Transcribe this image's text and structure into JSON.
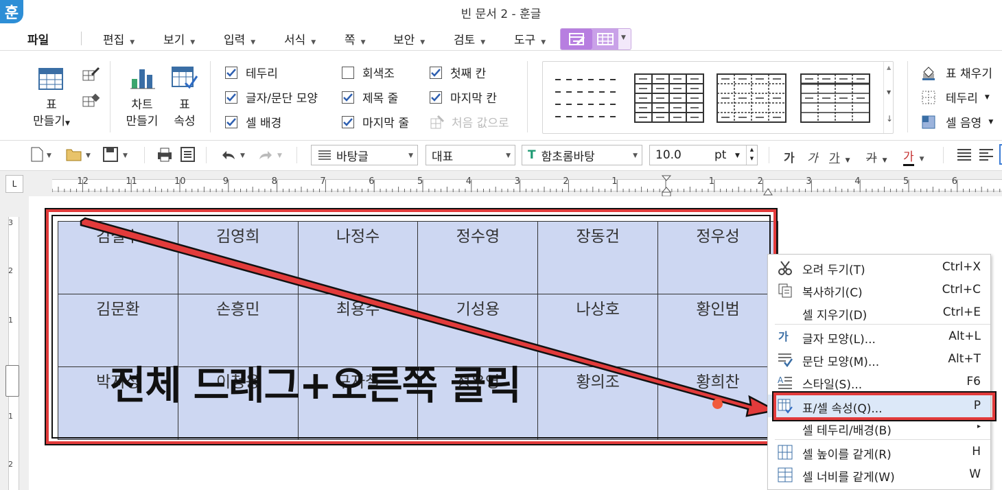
{
  "window": {
    "title": "빈 문서 2 - 훈글",
    "app_icon": "훈"
  },
  "menubar": {
    "items": [
      "파일",
      "편집",
      "보기",
      "입력",
      "서식",
      "쪽",
      "보안",
      "검토",
      "도구"
    ]
  },
  "ribbon": {
    "make_table": "표\n만들기",
    "make_table_l1": "표",
    "make_table_l2": "만들기",
    "chart_l1": "차트",
    "chart_l2": "만들기",
    "table_prop_l1": "표",
    "table_prop_l2": "속성",
    "checks": [
      {
        "label": "테두리",
        "checked": true
      },
      {
        "label": "글자/문단 모양",
        "checked": true
      },
      {
        "label": "셀 배경",
        "checked": true
      },
      {
        "label": "회색조",
        "checked": false
      },
      {
        "label": "제목 줄",
        "checked": true
      },
      {
        "label": "마지막 줄",
        "checked": true
      },
      {
        "label": "첫째 칸",
        "checked": true
      },
      {
        "label": "마지막 칸",
        "checked": true
      }
    ],
    "reset_default": "처음 값으로",
    "fill": "표 채우기",
    "border": "테두리",
    "shading": "셀 음영"
  },
  "toolbar": {
    "style": "바탕글",
    "language": "대표",
    "font": "함초롬바탕",
    "font_size": "10.0",
    "font_unit": "pt",
    "bold": "가",
    "italic": "가",
    "underline": "가",
    "strike": "가",
    "color": "가"
  },
  "ruler": {
    "corner": "L",
    "numbers": [
      "12",
      "11",
      "10",
      "9",
      "8",
      "7",
      "6",
      "5",
      "4",
      "3",
      "2",
      "1",
      "1",
      "2",
      "3",
      "4",
      "5",
      "6"
    ],
    "vnumbers": [
      "3",
      "2",
      "1",
      "1",
      "2"
    ]
  },
  "document": {
    "table": [
      [
        "김철수",
        "김영희",
        "나정수",
        "정수영",
        "장동건",
        "정우성"
      ],
      [
        "김문환",
        "손흥민",
        "최용수",
        "기성용",
        "나상호",
        "황인범"
      ],
      [
        "박지성",
        "이청용",
        "구자철",
        "정우영",
        "황의조",
        "황희찬"
      ]
    ],
    "caption": "전체 드래그+오른쪽 클릭"
  },
  "context_menu": {
    "items": [
      {
        "label": "오려 두기(T)",
        "shortcut": "Ctrl+X",
        "icon": "scissors-icon"
      },
      {
        "label": "복사하기(C)",
        "shortcut": "Ctrl+C",
        "icon": "copy-icon"
      },
      {
        "label": "셀 지우기(D)",
        "shortcut": "Ctrl+E",
        "icon": ""
      },
      {
        "label": "글자 모양(L)...",
        "shortcut": "Alt+L",
        "icon": "char-shape-icon"
      },
      {
        "label": "문단 모양(M)...",
        "shortcut": "Alt+T",
        "icon": "para-shape-icon"
      },
      {
        "label": "스타일(S)...",
        "shortcut": "F6",
        "icon": "style-icon"
      },
      {
        "label": "표/셀 속성(Q)...",
        "shortcut": "P",
        "icon": "table-props-icon"
      },
      {
        "label": "셀 테두리/배경(B)",
        "shortcut": "▸",
        "icon": ""
      },
      {
        "label": "셀 높이를 같게(R)",
        "shortcut": "H",
        "icon": "row-height-icon"
      },
      {
        "label": "셀 너비를 같게(W)",
        "shortcut": "W",
        "icon": "col-width-icon"
      }
    ]
  },
  "colors": {
    "annotation_red": "#e23b3b",
    "selection_blue": "#cdd7f2",
    "accent_purple": "#b77ee0"
  }
}
